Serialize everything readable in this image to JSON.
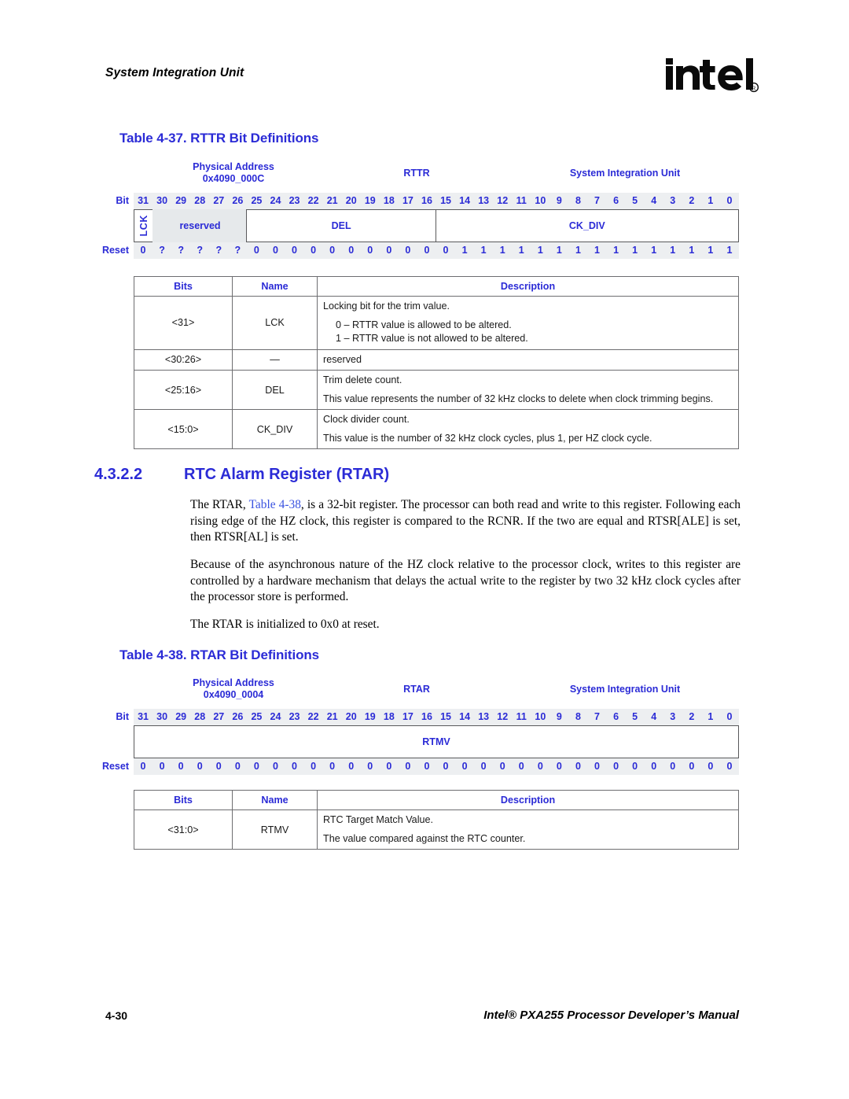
{
  "header": {
    "running_head": "System Integration Unit",
    "logo_text": "intel",
    "logo_mark": "®"
  },
  "table_rttr": {
    "caption": "Table 4-37. RTTR Bit Definitions",
    "figure": {
      "physical_address_label": "Physical Address",
      "physical_address_value": "0x4090_000C",
      "register_name": "RTTR",
      "unit": "System Integration Unit",
      "bit_row_label": "Bit",
      "reset_row_label": "Reset",
      "bits": [
        "31",
        "30",
        "29",
        "28",
        "27",
        "26",
        "25",
        "24",
        "23",
        "22",
        "21",
        "20",
        "19",
        "18",
        "17",
        "16",
        "15",
        "14",
        "13",
        "12",
        "11",
        "10",
        "9",
        "8",
        "7",
        "6",
        "5",
        "4",
        "3",
        "2",
        "1",
        "0"
      ],
      "fields": [
        {
          "name": "LCK",
          "width": 1,
          "vertical": true,
          "shaded": false
        },
        {
          "name": "reserved",
          "width": 5,
          "vertical": false,
          "shaded": true
        },
        {
          "name": "DEL",
          "width": 10,
          "vertical": false,
          "shaded": false
        },
        {
          "name": "CK_DIV",
          "width": 16,
          "vertical": false,
          "shaded": false
        }
      ],
      "reset": [
        "0",
        "?",
        "?",
        "?",
        "?",
        "?",
        "0",
        "0",
        "0",
        "0",
        "0",
        "0",
        "0",
        "0",
        "0",
        "0",
        "0",
        "1",
        "1",
        "1",
        "1",
        "1",
        "1",
        "1",
        "1",
        "1",
        "1",
        "1",
        "1",
        "1",
        "1",
        "1"
      ]
    },
    "columns": [
      "Bits",
      "Name",
      "Description"
    ],
    "rows": [
      {
        "bits": "<31>",
        "name": "LCK",
        "desc_main": "Locking bit for the trim value.",
        "desc_sub": [
          "0 – RTTR value is allowed to be altered.",
          "1 – RTTR value is not allowed to be altered."
        ],
        "desc_extra": ""
      },
      {
        "bits": "<30:26>",
        "name": "—",
        "desc_main": "reserved",
        "desc_sub": [],
        "desc_extra": ""
      },
      {
        "bits": "<25:16>",
        "name": "DEL",
        "desc_main": "Trim delete count.",
        "desc_sub": [],
        "desc_extra": "This value represents the number of 32 kHz clocks to delete when clock trimming begins."
      },
      {
        "bits": "<15:0>",
        "name": "CK_DIV",
        "desc_main": "Clock divider count.",
        "desc_sub": [],
        "desc_extra": "This value is the number of 32 kHz clock cycles, plus 1, per HZ clock cycle."
      }
    ]
  },
  "section": {
    "number": "4.3.2.2",
    "title": "RTC Alarm Register (RTAR)",
    "para1_a": "The RTAR, ",
    "para1_xref": "Table 4-38",
    "para1_b": ", is a 32-bit register. The processor can both read and write to this register. Following each rising edge of the HZ clock, this register is compared to the RCNR. If the two are equal and RTSR[ALE] is set, then RTSR[AL] is set.",
    "para2": "Because of the asynchronous nature of the HZ clock relative to the processor clock, writes to this register are controlled by a hardware mechanism that delays the actual write to the register by two 32 kHz clock cycles after the processor store is performed.",
    "para3": "The RTAR is initialized to 0x0 at reset."
  },
  "table_rtar": {
    "caption": "Table 4-38. RTAR Bit Definitions",
    "figure": {
      "physical_address_label": "Physical Address",
      "physical_address_value": "0x4090_0004",
      "register_name": "RTAR",
      "unit": "System Integration Unit",
      "bit_row_label": "Bit",
      "reset_row_label": "Reset",
      "bits": [
        "31",
        "30",
        "29",
        "28",
        "27",
        "26",
        "25",
        "24",
        "23",
        "22",
        "21",
        "20",
        "19",
        "18",
        "17",
        "16",
        "15",
        "14",
        "13",
        "12",
        "11",
        "10",
        "9",
        "8",
        "7",
        "6",
        "5",
        "4",
        "3",
        "2",
        "1",
        "0"
      ],
      "fields": [
        {
          "name": "RTMV",
          "width": 32,
          "vertical": false,
          "shaded": false
        }
      ],
      "reset": [
        "0",
        "0",
        "0",
        "0",
        "0",
        "0",
        "0",
        "0",
        "0",
        "0",
        "0",
        "0",
        "0",
        "0",
        "0",
        "0",
        "0",
        "0",
        "0",
        "0",
        "0",
        "0",
        "0",
        "0",
        "0",
        "0",
        "0",
        "0",
        "0",
        "0",
        "0",
        "0"
      ]
    },
    "columns": [
      "Bits",
      "Name",
      "Description"
    ],
    "rows": [
      {
        "bits": "<31:0>",
        "name": "RTMV",
        "desc_main": "RTC Target Match Value.",
        "desc_sub": [],
        "desc_extra": "The value compared against the RTC counter."
      }
    ]
  },
  "footer": {
    "page_number": "4-30",
    "manual_title": "Intel® PXA255 Processor Developer’s Manual"
  },
  "colors": {
    "accent_blue": "#2B2BD6",
    "xref_blue": "#3A53E0",
    "row_band": "#EDEFF1",
    "field_border": "#59595B"
  }
}
